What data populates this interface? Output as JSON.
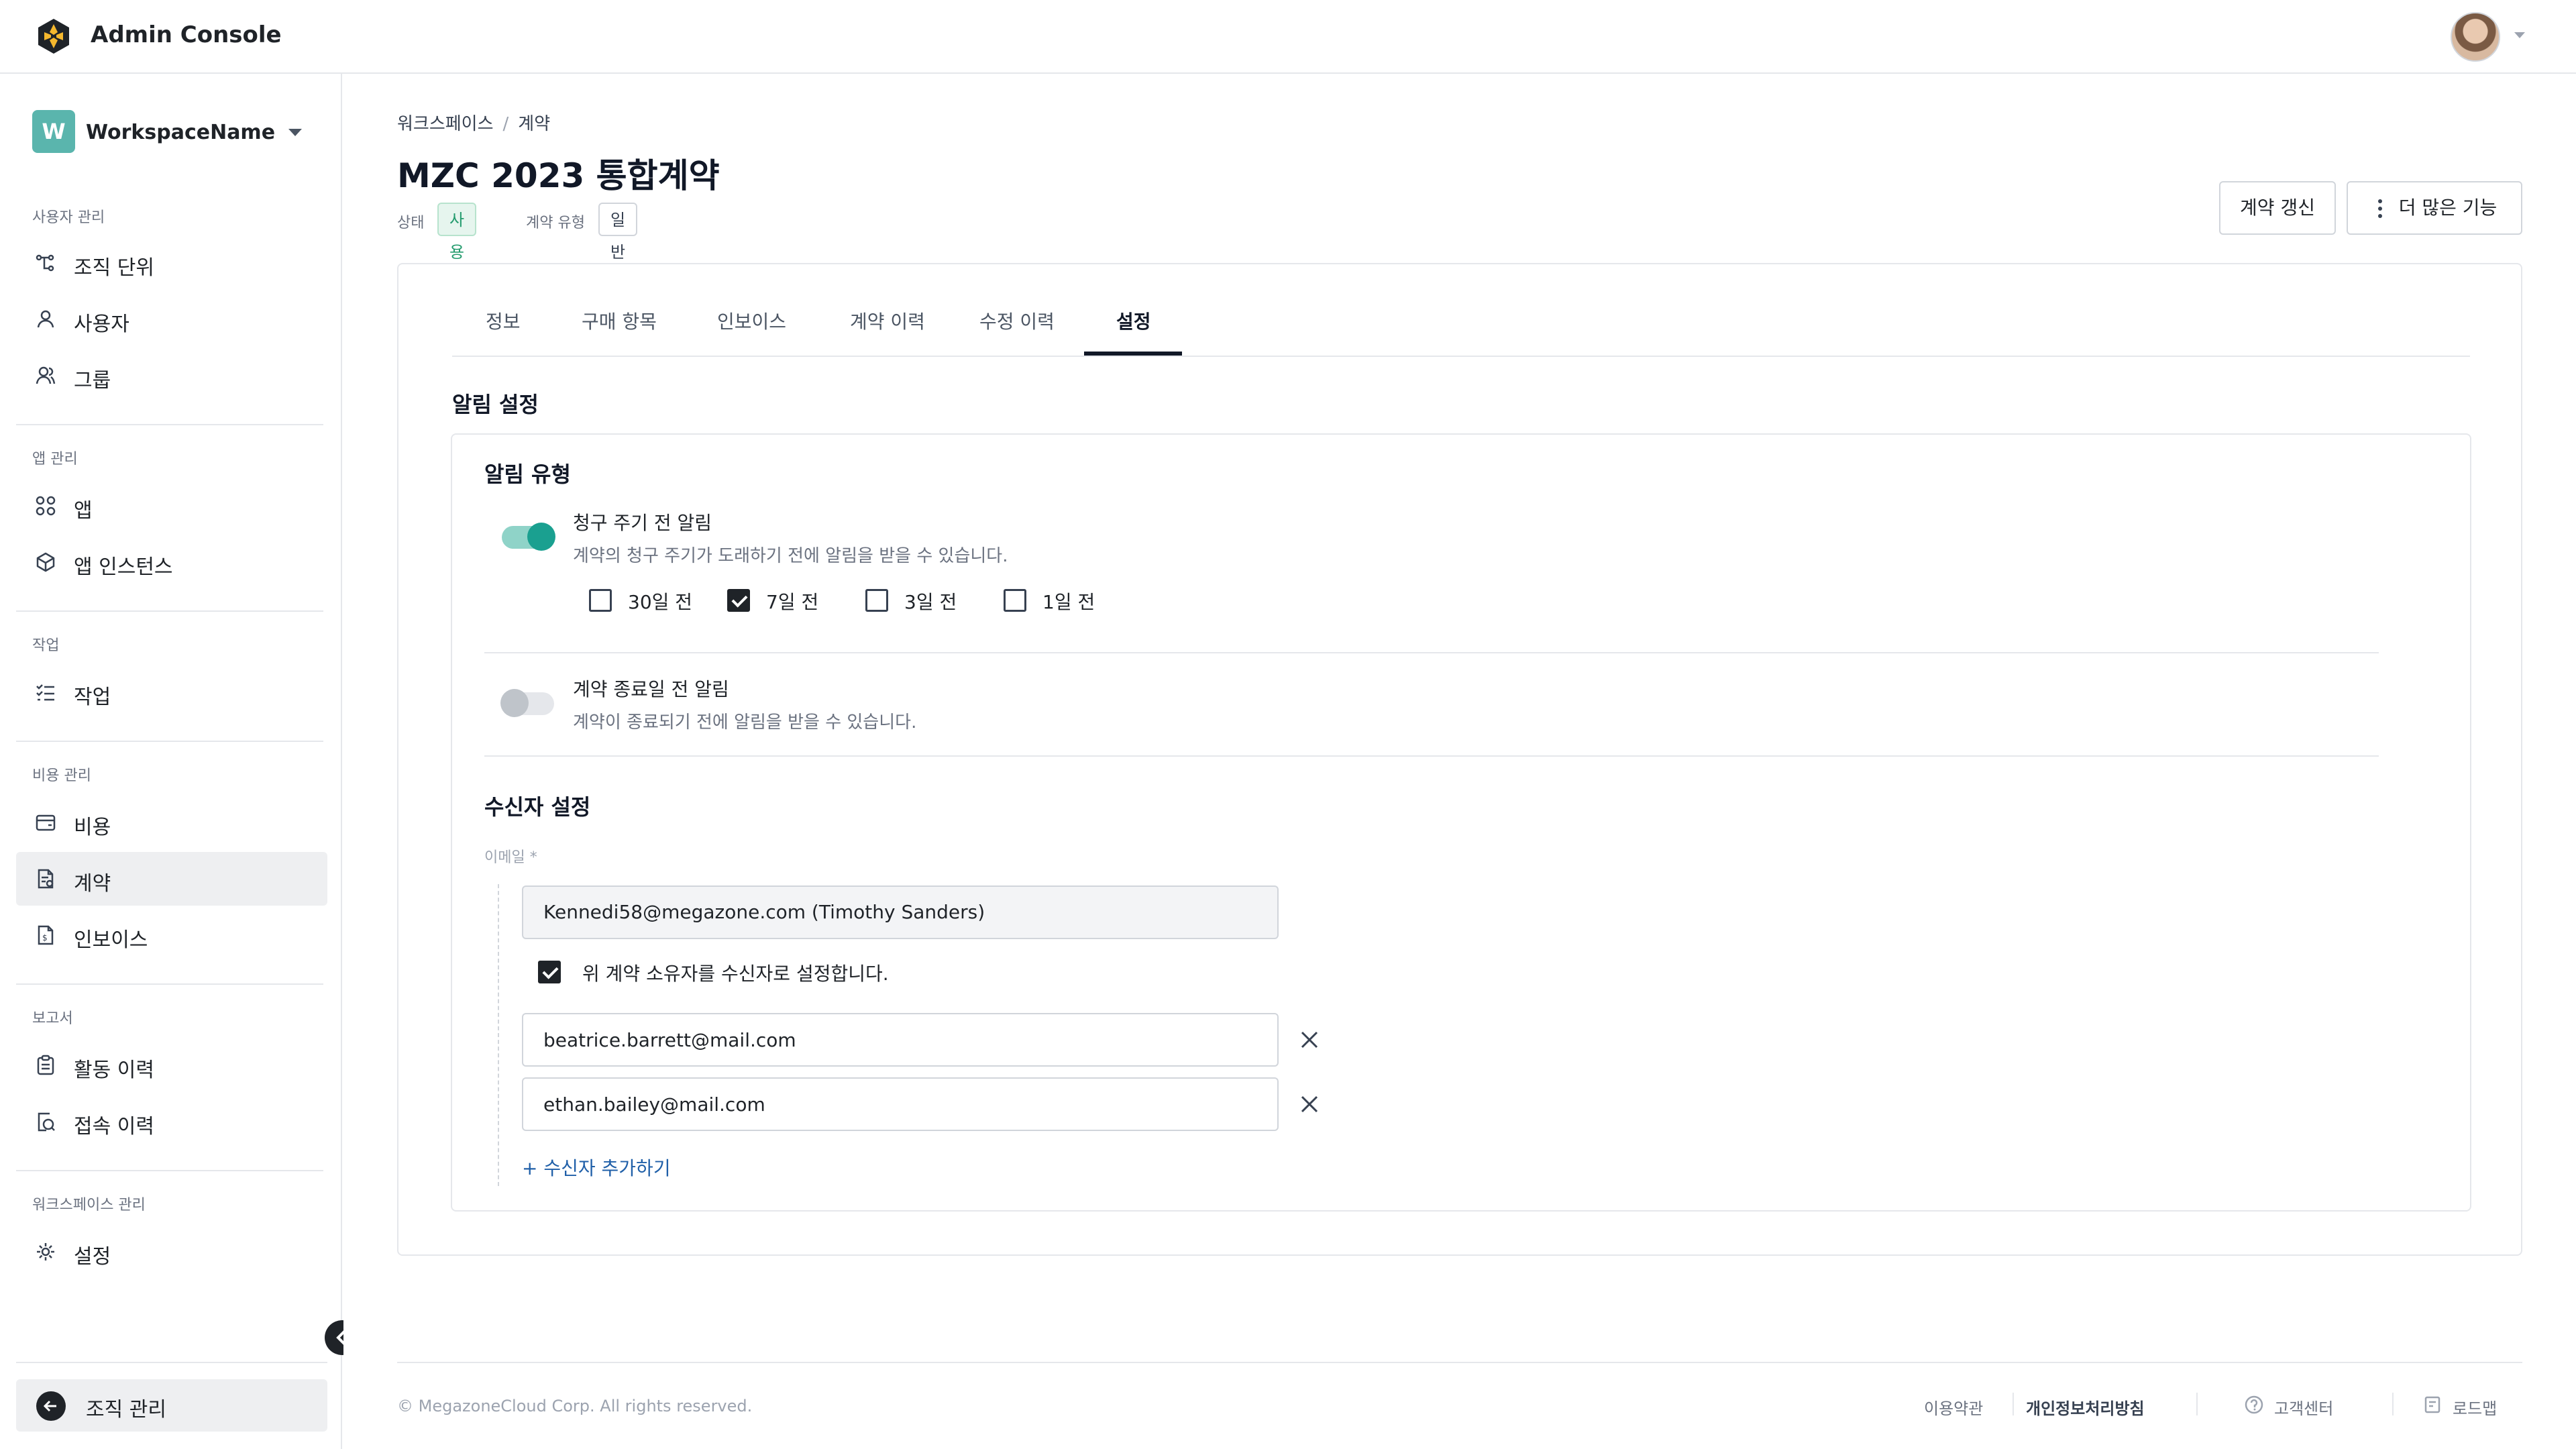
{
  "header": {
    "title": "Admin Console"
  },
  "sidebar": {
    "workspace": {
      "badge": "W",
      "name": "WorkspaceName"
    },
    "sections": [
      {
        "label": "사용자 관리",
        "items": [
          {
            "label": "조직 단위",
            "icon": "org-tree-icon"
          },
          {
            "label": "사용자",
            "icon": "user-icon"
          },
          {
            "label": "그룹",
            "icon": "group-icon"
          }
        ]
      },
      {
        "label": "앱 관리",
        "items": [
          {
            "label": "앱",
            "icon": "apps-grid-icon"
          },
          {
            "label": "앱 인스턴스",
            "icon": "cube-icon"
          }
        ]
      },
      {
        "label": "작업",
        "items": [
          {
            "label": "작업",
            "icon": "checklist-icon"
          }
        ]
      },
      {
        "label": "비용 관리",
        "items": [
          {
            "label": "비용",
            "icon": "wallet-icon"
          },
          {
            "label": "계약",
            "icon": "contract-icon",
            "active": true
          },
          {
            "label": "인보이스",
            "icon": "invoice-icon"
          }
        ]
      },
      {
        "label": "보고서",
        "items": [
          {
            "label": "활동 이력",
            "icon": "clipboard-icon"
          },
          {
            "label": "접속 이력",
            "icon": "access-history-icon"
          }
        ]
      },
      {
        "label": "워크스페이스 관리",
        "items": [
          {
            "label": "설정",
            "icon": "gear-icon"
          }
        ]
      }
    ],
    "bottom_label": "조직 관리"
  },
  "page": {
    "breadcrumb": [
      "워크스페이스",
      "계약"
    ],
    "title": "MZC 2023 통합계약",
    "status_label": "상태",
    "status_value": "사용중",
    "type_label": "계약 유형",
    "type_value": "일반",
    "renew_button": "계약 갱신",
    "more_button": "더 많은 기능"
  },
  "tabs": [
    "정보",
    "구매 항목",
    "인보이스",
    "계약 이력",
    "수정 이력",
    "설정"
  ],
  "active_tab": "설정",
  "notification": {
    "section_title": "알림 설정",
    "type_title": "알림 유형",
    "billing": {
      "enabled": true,
      "title": "청구 주기 전 알림",
      "desc": "계약의 청구 주기가 도래하기 전에 알림을 받을 수 있습니다.",
      "options": [
        {
          "label": "30일 전",
          "checked": false
        },
        {
          "label": "7일 전",
          "checked": true
        },
        {
          "label": "3일 전",
          "checked": false
        },
        {
          "label": "1일 전",
          "checked": false
        }
      ]
    },
    "end": {
      "enabled": false,
      "title": "계약 종료일 전 알림",
      "desc": "계약이 종료되기 전에 알림을 받을 수 있습니다."
    }
  },
  "recipients": {
    "title": "수신자 설정",
    "email_label": "이메일 *",
    "owner_email": "Kennedi58@megazone.com (Timothy Sanders)",
    "owner_checkbox_label": "위 계약 소유자를 수신자로 설정합니다.",
    "owner_checked": true,
    "emails": [
      "beatrice.barrett@mail.com",
      "ethan.bailey@mail.com"
    ],
    "add_label": "+ 수신자 추가하기"
  },
  "footer": {
    "copyright": "© MegazoneCloud Corp. All rights reserved.",
    "terms": "이용약관",
    "privacy": "개인정보처리방침",
    "support": "고객센터",
    "roadmap": "로드맵"
  },
  "colors": {
    "accent_teal": "#1aa090",
    "status_green": "#239b6d",
    "workspace_badge": "#5ab5ad",
    "link_blue": "#1f5fa8"
  }
}
